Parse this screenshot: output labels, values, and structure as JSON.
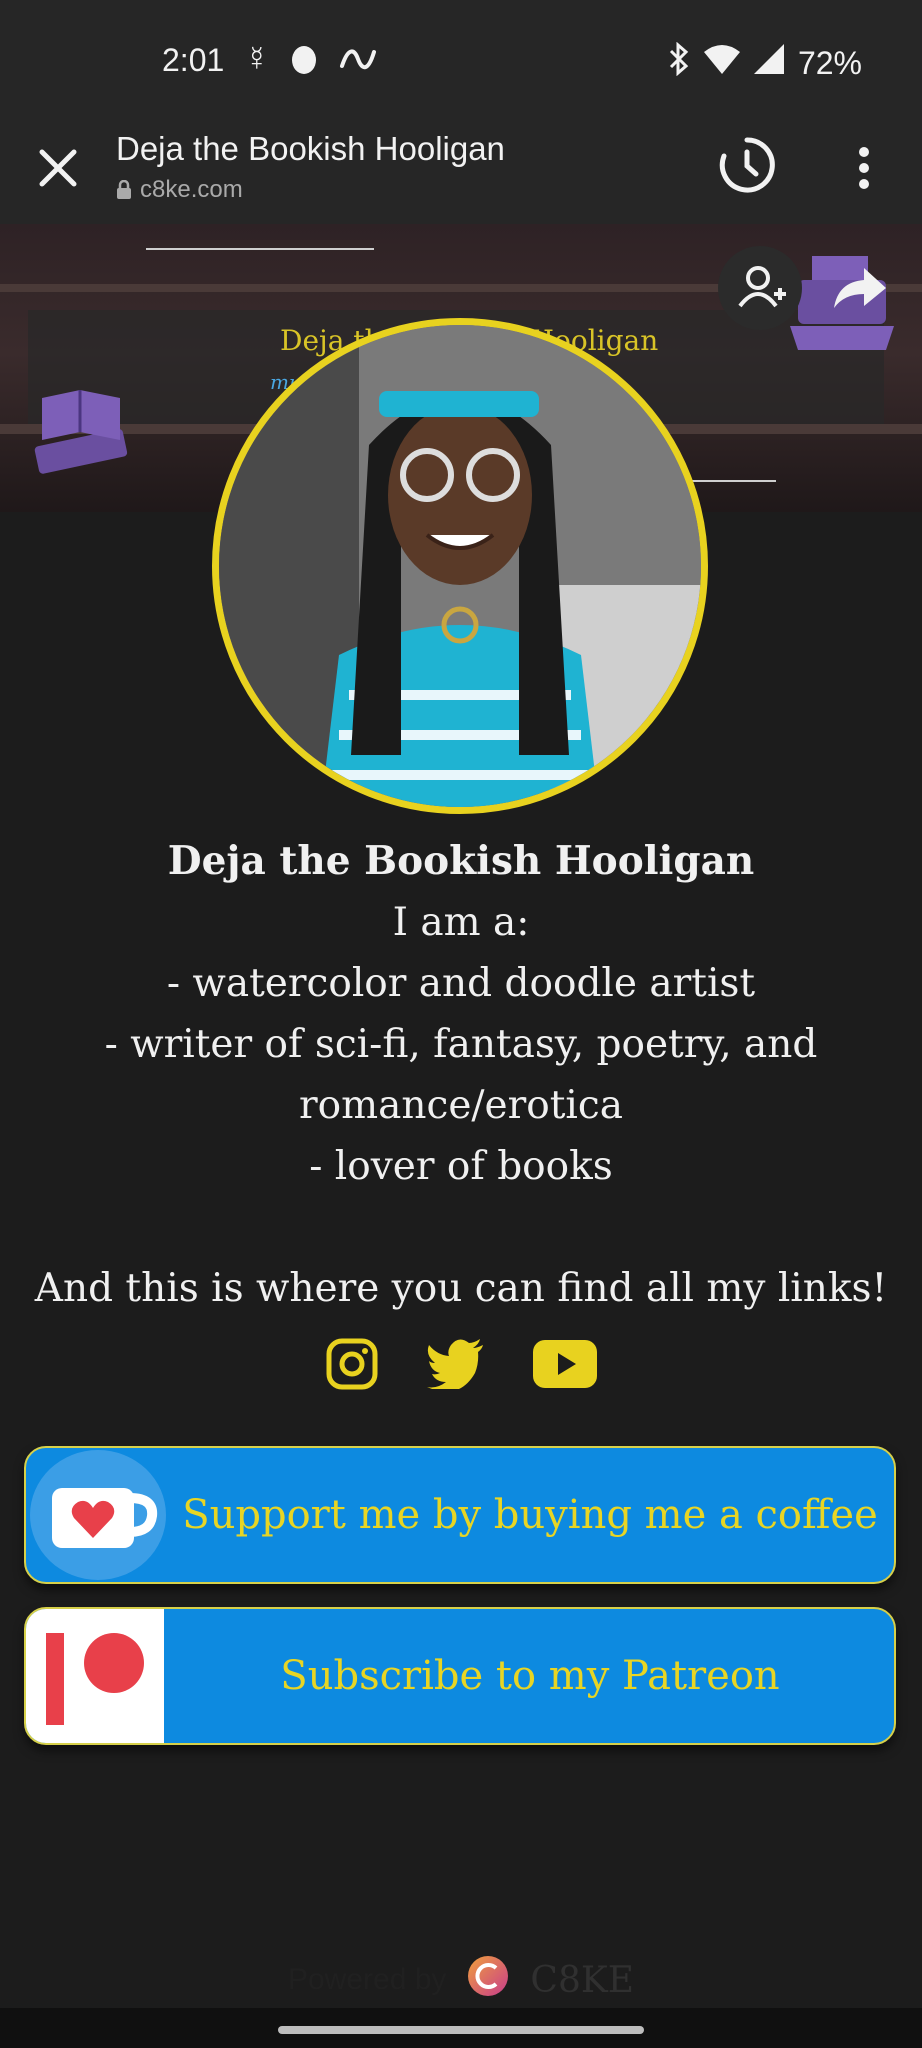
{
  "status_bar": {
    "time": "2:01",
    "battery": "72%",
    "icons": [
      "mercury-icon",
      "moon-icon",
      "wave-icon",
      "bluetooth-icon",
      "wifi-icon",
      "signal-icon"
    ]
  },
  "toolbar": {
    "title": "Deja the Bookish Hooligan",
    "url": "c8ke.com"
  },
  "banner": {
    "title": "Deja the Bookish Hooligan",
    "subtitle": "mu...ks"
  },
  "profile": {
    "name": "Deja the Bookish Hooligan",
    "bio_lines": [
      "I am a:",
      "- watercolor and doodle artist",
      "- writer of sci-fi, fantasy, poetry, and",
      "romance/erotica",
      "- lover of books",
      "",
      "And this is where you can find all my links!"
    ]
  },
  "social": [
    "instagram-icon",
    "twitter-icon",
    "youtube-icon"
  ],
  "links": [
    {
      "label": "Support me by buying me a coffee",
      "icon": "coffee-cup-icon"
    },
    {
      "label": "Subscribe to my Patreon",
      "icon": "patreon-icon"
    }
  ],
  "footer": {
    "powered_by": "Powered by",
    "brand": "C8KE"
  },
  "colors": {
    "accent_yellow": "#e8d21f",
    "button_blue": "#0d8ae0",
    "background": "#1c1c1c"
  }
}
